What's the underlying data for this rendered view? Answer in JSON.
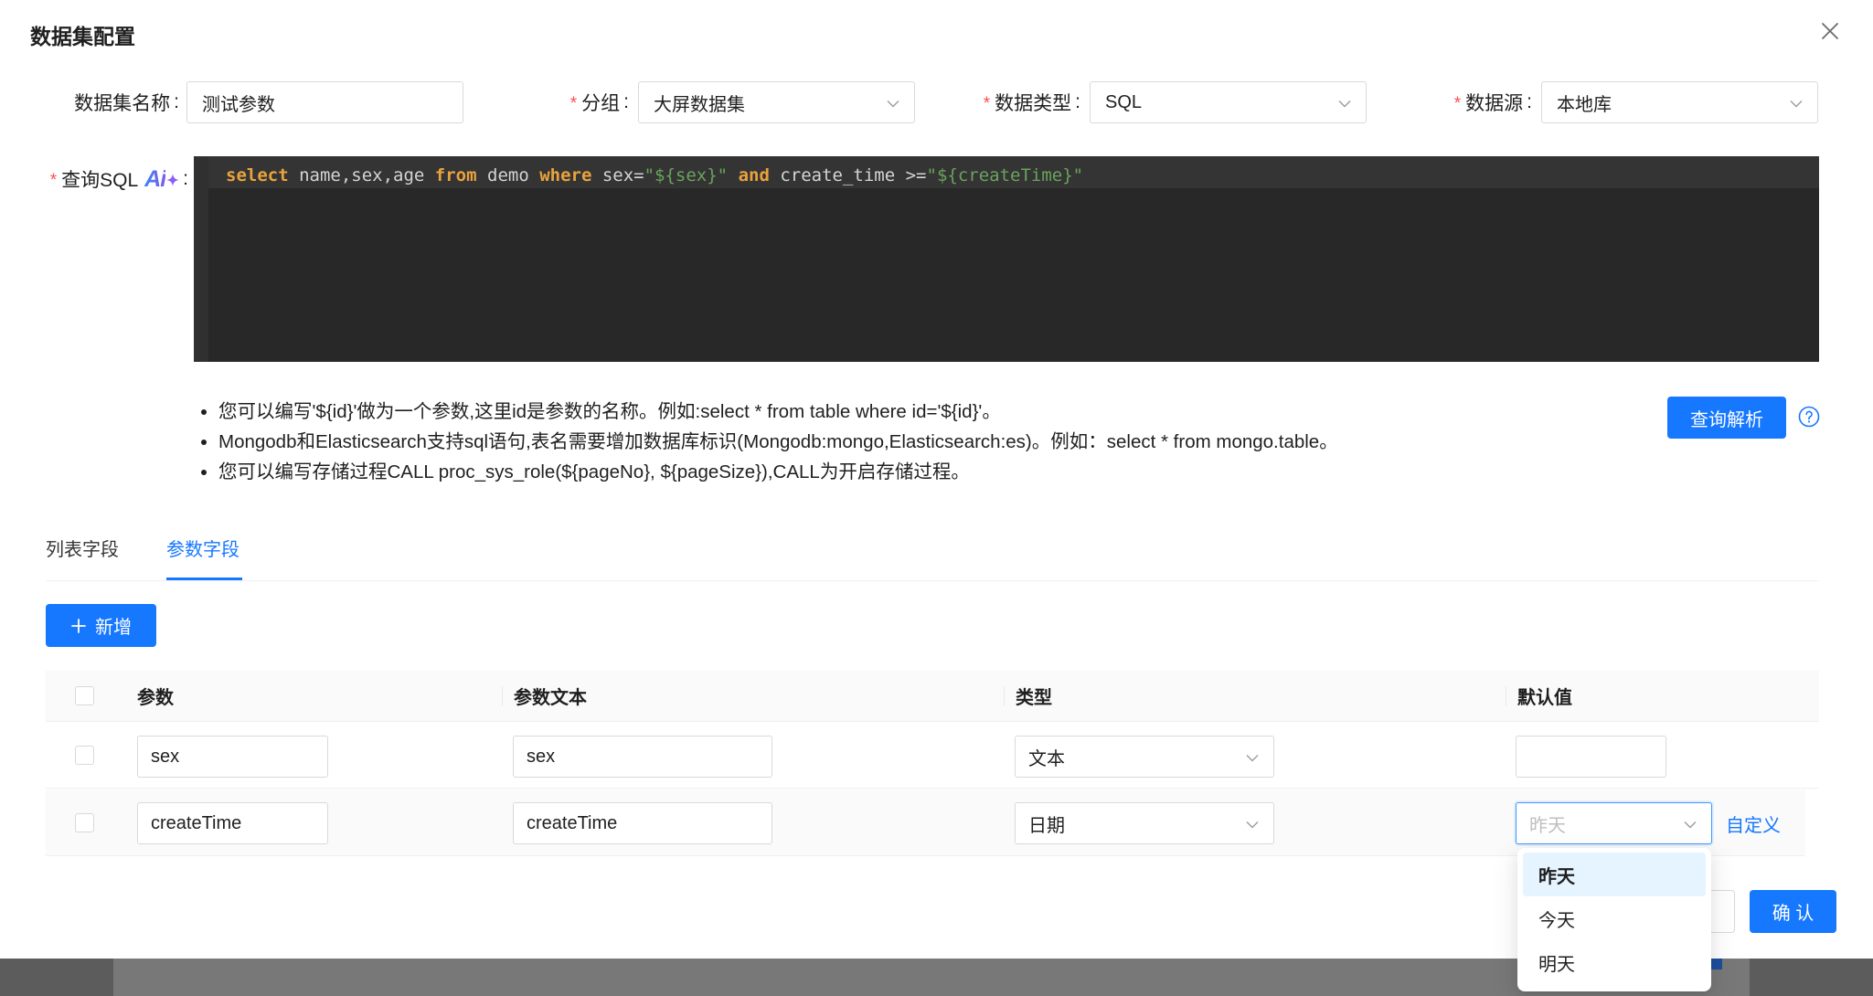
{
  "modal": {
    "title": "数据集配置"
  },
  "form": {
    "required_mark": "*",
    "colon": ":",
    "name": {
      "label": "数据集名称",
      "value": "测试参数"
    },
    "group": {
      "label": "分组",
      "value": "大屏数据集",
      "required": true
    },
    "data_type": {
      "label": "数据类型",
      "value": "SQL",
      "required": true
    },
    "data_source": {
      "label": "数据源",
      "value": "本地库",
      "required": true
    },
    "sql": {
      "label": "查询SQL",
      "required": true,
      "ai_icon_text": "Ai",
      "tokens": [
        {
          "text": "select",
          "type": "keyword"
        },
        {
          "text": " name,sex,age ",
          "type": "plain"
        },
        {
          "text": "from",
          "type": "keyword"
        },
        {
          "text": " demo ",
          "type": "plain"
        },
        {
          "text": "where",
          "type": "keyword"
        },
        {
          "text": " sex=",
          "type": "plain"
        },
        {
          "text": "\"${sex}\"",
          "type": "string"
        },
        {
          "text": " ",
          "type": "plain"
        },
        {
          "text": "and",
          "type": "keyword"
        },
        {
          "text": " create_time >=",
          "type": "plain"
        },
        {
          "text": "\"${createTime}\"",
          "type": "string"
        }
      ]
    }
  },
  "tips": [
    "您可以编写'${id}'做为一个参数,这里id是参数的名称。例如:select * from table where id='${id}'。",
    "Mongodb和Elasticsearch支持sql语句,表名需要增加数据库标识(Mongodb:mongo,Elasticsearch:es)。例如：select * from mongo.table。",
    "您可以编写存储过程CALL proc_sys_role(${pageNo}, ${pageSize}),CALL为开启存储过程。"
  ],
  "parse_button": "查询解析",
  "tabs": [
    {
      "label": "列表字段",
      "active": false
    },
    {
      "label": "参数字段",
      "active": true
    }
  ],
  "add_button": "新增",
  "table": {
    "columns": [
      "参数",
      "参数文本",
      "类型",
      "默认值"
    ],
    "rows": [
      {
        "param": "sex",
        "text": "sex",
        "type": "文本",
        "default": ""
      },
      {
        "param": "createTime",
        "text": "createTime",
        "type": "日期",
        "default_placeholder": "昨天",
        "custom_link": "自定义"
      }
    ]
  },
  "dropdown": {
    "options": [
      {
        "label": "昨天",
        "selected": true
      },
      {
        "label": "今天",
        "selected": false
      },
      {
        "label": "明天",
        "selected": false
      }
    ]
  },
  "footer": {
    "confirm": "确 认"
  },
  "icons": {
    "close": "close-icon",
    "chevron": "chevron-down-icon",
    "ai": "ai-sparkle-icon",
    "help": "question-circle-icon",
    "plus": "plus-icon"
  },
  "colors": {
    "primary": "#1677ff",
    "required": "#ff4d4f",
    "code_keyword": "#e8a33d",
    "code_string": "#6aa35c",
    "code_plain": "#d4d4d4",
    "editor_bg": "#282828"
  }
}
